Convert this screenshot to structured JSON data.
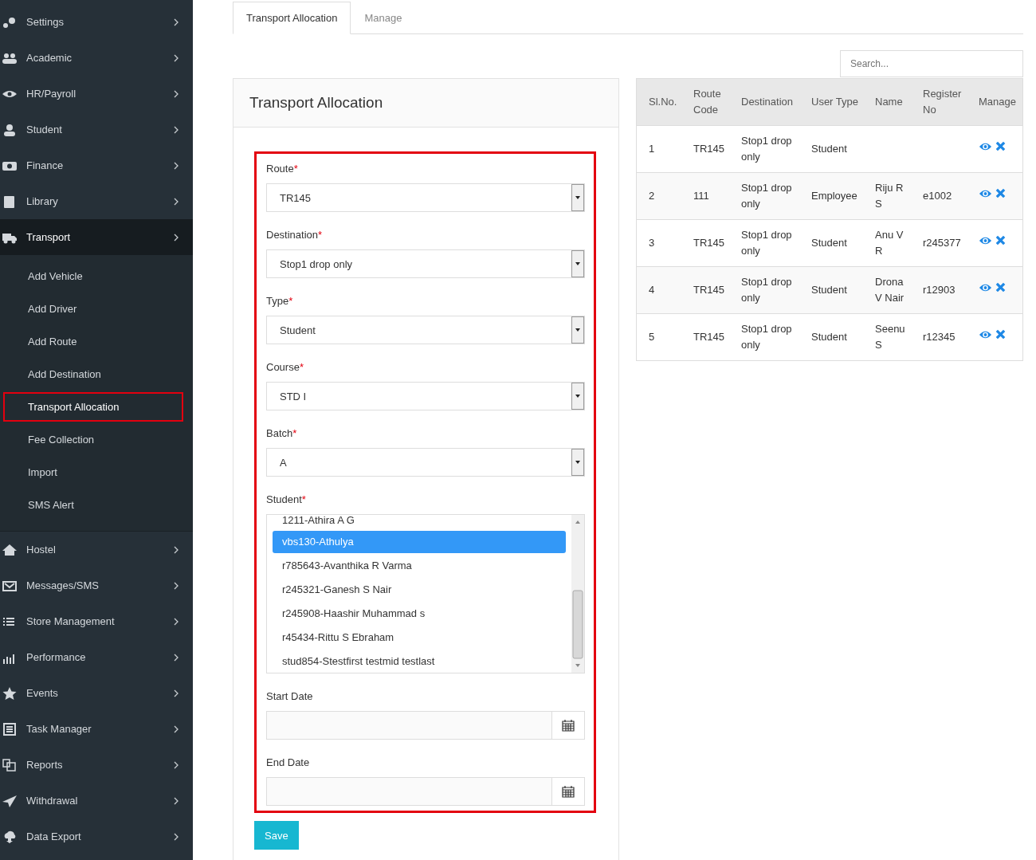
{
  "sidebar": {
    "items": [
      {
        "label": "Settings",
        "expanded": false
      },
      {
        "label": "Academic",
        "expanded": false
      },
      {
        "label": "HR/Payroll",
        "expanded": false
      },
      {
        "label": "Student",
        "expanded": false
      },
      {
        "label": "Finance",
        "expanded": false
      },
      {
        "label": "Library",
        "expanded": false
      },
      {
        "label": "Transport",
        "expanded": true,
        "children": [
          {
            "label": "Add Vehicle",
            "selected": false
          },
          {
            "label": "Add Driver",
            "selected": false
          },
          {
            "label": "Add Route",
            "selected": false
          },
          {
            "label": "Add Destination",
            "selected": false
          },
          {
            "label": "Transport Allocation",
            "selected": true
          },
          {
            "label": "Fee Collection",
            "selected": false
          },
          {
            "label": "Import",
            "selected": false
          },
          {
            "label": "SMS Alert",
            "selected": false
          }
        ]
      },
      {
        "label": "Hostel",
        "expanded": false
      },
      {
        "label": "Messages/SMS",
        "expanded": false
      },
      {
        "label": "Store Management",
        "expanded": false
      },
      {
        "label": "Performance",
        "expanded": false
      },
      {
        "label": "Events",
        "expanded": false
      },
      {
        "label": "Task Manager",
        "expanded": false
      },
      {
        "label": "Reports",
        "expanded": false
      },
      {
        "label": "Withdrawal",
        "expanded": false
      },
      {
        "label": "Data Export",
        "expanded": false
      }
    ]
  },
  "tabs": [
    {
      "label": "Transport Allocation",
      "selected": true
    },
    {
      "label": "Manage",
      "selected": false
    }
  ],
  "search": {
    "placeholder": "Search..."
  },
  "form": {
    "title": "Transport Allocation",
    "fields": [
      {
        "kind": "select",
        "label": "Route",
        "required_mark": "*",
        "value": "TR145"
      },
      {
        "kind": "select",
        "label": "Destination",
        "required_mark": "*",
        "value": "Stop1 drop only"
      },
      {
        "kind": "select",
        "label": "Type",
        "required_mark": "*",
        "value": "Student"
      },
      {
        "kind": "select",
        "label": "Course",
        "required_mark": "*",
        "value": "STD I"
      },
      {
        "kind": "select",
        "label": "Batch",
        "required_mark": "*",
        "value": "A"
      },
      {
        "kind": "listbox",
        "label": "Student",
        "required_mark": "*",
        "options": [
          {
            "label": "1211-Athira A G",
            "selected": false
          },
          {
            "label": "vbs130-Athulya",
            "selected": true
          },
          {
            "label": "r785643-Avanthika R Varma",
            "selected": false
          },
          {
            "label": "r245321-Ganesh S Nair",
            "selected": false
          },
          {
            "label": "r245908-Haashir Muhammad s",
            "selected": false
          },
          {
            "label": "r45434-Rittu S Ebraham",
            "selected": false
          },
          {
            "label": "stud854-Stestfirst testmid testlast",
            "selected": false
          }
        ]
      },
      {
        "kind": "date",
        "label": "Start Date"
      },
      {
        "kind": "date",
        "label": "End Date"
      }
    ],
    "save_button": "Save"
  },
  "table": {
    "columns": [
      "Sl.No.",
      "Route Code",
      "Destination",
      "User Type",
      "Name",
      "Register No",
      "Manage"
    ],
    "rows": [
      [
        "1",
        "TR145",
        "Stop1 drop only",
        "Student",
        "",
        ""
      ],
      [
        "2",
        "111",
        "Stop1 drop only",
        "Employee",
        "Riju R S",
        "e1002"
      ],
      [
        "3",
        "TR145",
        "Stop1 drop only",
        "Student",
        "Anu V R",
        "r245377"
      ],
      [
        "4",
        "TR145",
        "Stop1 drop only",
        "Student",
        "Drona V Nair",
        "r12903"
      ],
      [
        "5",
        "TR145",
        "Stop1 drop only",
        "Student",
        "Seenu S",
        "r12345"
      ]
    ]
  }
}
